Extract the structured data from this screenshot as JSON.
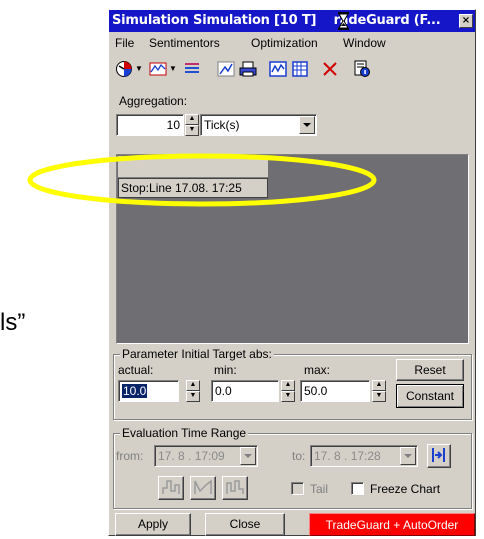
{
  "side_text": "ls”",
  "window": {
    "title": "Simulation  Simulation [10 T] ",
    "title_tail": "radeGuard (F...",
    "close_glyph": "×"
  },
  "menu": [
    "File",
    "Sentimentors",
    "Optimization",
    "Window"
  ],
  "toolbar": {
    "icons": [
      "clock-icon",
      "chart-icon",
      "list-icon",
      "line-tool-icon",
      "print-icon",
      "grid-icon",
      "table-icon",
      "delete-icon",
      "info-icon"
    ]
  },
  "aggregation": {
    "label": "Aggregation:",
    "value": "10",
    "unit": "Tick(s)"
  },
  "chart": {
    "popup_label": "Stop:Line 17.08. 17:25",
    "highlight_color": "#ffff00"
  },
  "param": {
    "group_title": "Parameter Initial Target abs:",
    "actual_label": "actual:",
    "min_label": "min:",
    "max_label": "max:",
    "actual_value": "10.0",
    "min_value": "0.0",
    "max_value": "50.0",
    "reset_label": "Reset",
    "constant_label": "Constant"
  },
  "eval": {
    "group_title": "Evaluation Time Range",
    "from_label": "from:",
    "from_value": "17. 8 . 17:09",
    "to_label": "to:",
    "to_value": "17. 8 . 17:28",
    "tail_label": "Tail",
    "freeze_label": "Freeze Chart"
  },
  "bottom": {
    "apply_label": "Apply",
    "close_label": "Close",
    "order_label": "TradeGuard + AutoOrder"
  }
}
